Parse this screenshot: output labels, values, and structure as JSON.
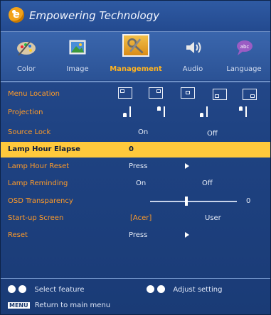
{
  "brand": {
    "text": "Empowering Technology",
    "logo_letter": "e"
  },
  "tabs": [
    {
      "label": "Color",
      "icon": "palette-icon",
      "active": false
    },
    {
      "label": "Image",
      "icon": "picture-icon",
      "active": false
    },
    {
      "label": "Management",
      "icon": "tools-icon",
      "active": true
    },
    {
      "label": "Audio",
      "icon": "speaker-icon",
      "active": false
    },
    {
      "label": "Language",
      "icon": "speech-bubble-icon",
      "active": false
    }
  ],
  "menu": {
    "menu_location": {
      "label": "Menu Location"
    },
    "projection": {
      "label": "Projection"
    },
    "source_lock": {
      "label": "Source Lock",
      "option1": "On",
      "option2": "Off"
    },
    "lamp_hour_elapse": {
      "label": "Lamp Hour Elapse",
      "value": "0"
    },
    "lamp_hour_reset": {
      "label": "Lamp Hour Reset",
      "value": "Press"
    },
    "lamp_reminding": {
      "label": "Lamp Reminding",
      "option1": "On",
      "option2": "Off"
    },
    "osd_transparency": {
      "label": "OSD Transparency",
      "value": "0"
    },
    "startup_screen": {
      "label": "Start-up Screen",
      "option1": "[Acer]",
      "option2": "User"
    },
    "reset": {
      "label": "Reset",
      "value": "Press"
    }
  },
  "footer": {
    "select": "Select feature",
    "adjust": "Adjust setting",
    "menu_key": "MENU",
    "return": "Return to main menu"
  },
  "colors": {
    "accent": "#ff9b28",
    "highlight": "#ffc93c",
    "background": "#1f4383"
  }
}
